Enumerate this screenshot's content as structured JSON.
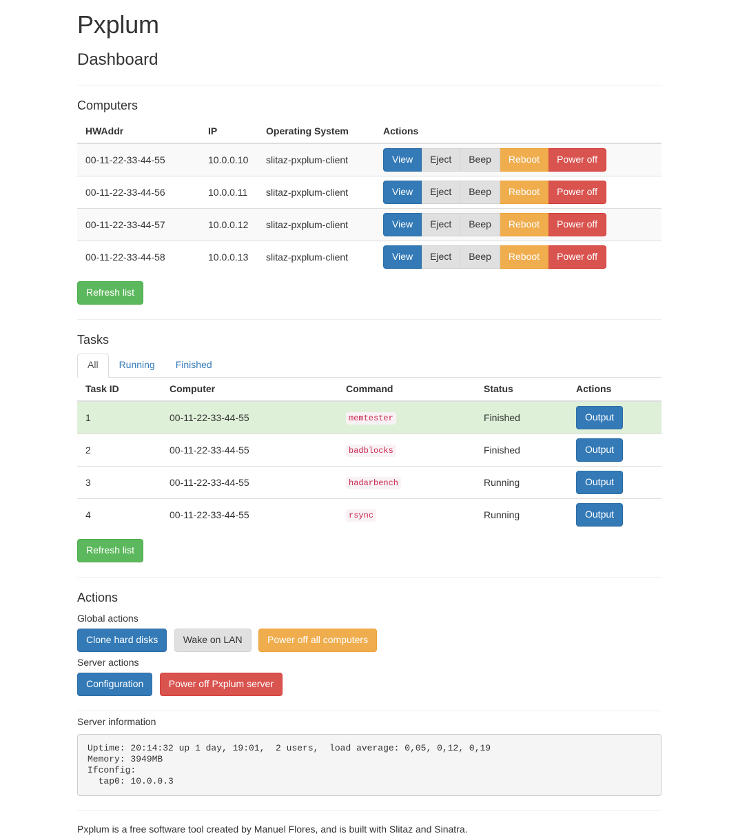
{
  "header": {
    "app_title": "Pxplum",
    "page_subtitle": "Dashboard"
  },
  "computers": {
    "heading": "Computers",
    "columns": [
      "HWAddr",
      "IP",
      "Operating System",
      "Actions"
    ],
    "rows": [
      {
        "hwaddr": "00-11-22-33-44-55",
        "ip": "10.0.0.10",
        "os": "slitaz-pxplum-client"
      },
      {
        "hwaddr": "00-11-22-33-44-56",
        "ip": "10.0.0.11",
        "os": "slitaz-pxplum-client"
      },
      {
        "hwaddr": "00-11-22-33-44-57",
        "ip": "10.0.0.12",
        "os": "slitaz-pxplum-client"
      },
      {
        "hwaddr": "00-11-22-33-44-58",
        "ip": "10.0.0.13",
        "os": "slitaz-pxplum-client"
      }
    ],
    "row_actions": {
      "view": "View",
      "eject": "Eject",
      "beep": "Beep",
      "reboot": "Reboot",
      "power_off": "Power off"
    },
    "refresh_label": "Refresh list"
  },
  "tasks": {
    "heading": "Tasks",
    "tabs": [
      {
        "label": "All",
        "active": true
      },
      {
        "label": "Running",
        "active": false
      },
      {
        "label": "Finished",
        "active": false
      }
    ],
    "columns": [
      "Task ID",
      "Computer",
      "Command",
      "Status",
      "Actions"
    ],
    "rows": [
      {
        "task_id": "1",
        "computer": "00-11-22-33-44-55",
        "command": "memtester",
        "status": "Finished",
        "highlight": "success"
      },
      {
        "task_id": "2",
        "computer": "00-11-22-33-44-55",
        "command": "badblocks",
        "status": "Finished",
        "highlight": ""
      },
      {
        "task_id": "3",
        "computer": "00-11-22-33-44-55",
        "command": "hadarbench",
        "status": "Running",
        "highlight": ""
      },
      {
        "task_id": "4",
        "computer": "00-11-22-33-44-55",
        "command": "rsync",
        "status": "Running",
        "highlight": ""
      }
    ],
    "output_label": "Output",
    "refresh_label": "Refresh list"
  },
  "actions": {
    "heading": "Actions",
    "global_label": "Global actions",
    "global_buttons": [
      {
        "label": "Clone hard disks",
        "style": "primary"
      },
      {
        "label": "Wake on LAN",
        "style": "default"
      },
      {
        "label": "Power off all computers",
        "style": "warning"
      }
    ],
    "server_label": "Server actions",
    "server_buttons": [
      {
        "label": "Configuration",
        "style": "primary"
      },
      {
        "label": "Power off Pxplum server",
        "style": "danger"
      }
    ]
  },
  "server_information": {
    "heading": "Server information",
    "text": "Uptime: 20:14:32 up 1 day, 19:01,  2 users,  load average: 0,05, 0,12, 0,19\nMemory: 3949MB\nIfconfig:\n  tap0: 10.0.0.3"
  },
  "footer": {
    "text": "Pxplum is a free software tool created by Manuel Flores, and is built with Slitaz and Sinatra."
  },
  "colors": {
    "primary": "#337ab7",
    "default": "#e0e0e0",
    "warning": "#f0ad4e",
    "danger": "#d9534f",
    "success": "#5cb85c",
    "row_success_bg": "#dff0d8",
    "code_text": "#c7254e",
    "code_bg": "#f9f2f4"
  }
}
